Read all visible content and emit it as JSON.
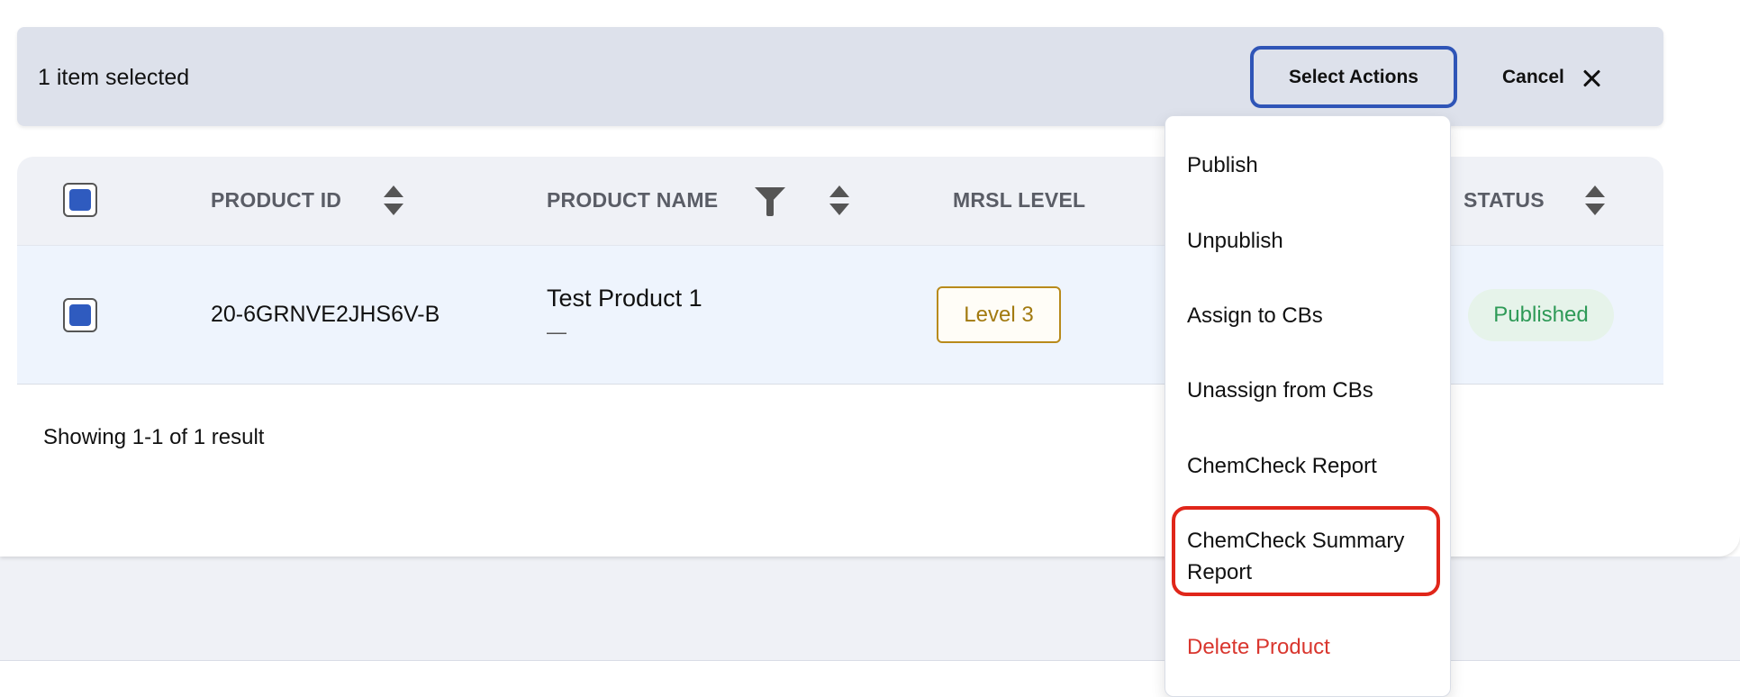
{
  "selection_bar": {
    "count_text": "1 item selected",
    "select_actions_label": "Select Actions",
    "cancel_label": "Cancel"
  },
  "table": {
    "columns": [
      {
        "label": "PRODUCT ID",
        "sortable": true
      },
      {
        "label": "PRODUCT NAME",
        "sortable": true,
        "filterable": true
      },
      {
        "label": "MRSL LEVEL"
      },
      {
        "label": "STATUS",
        "sortable": true
      }
    ],
    "rows": [
      {
        "checked": true,
        "product_id": "20-6GRNVE2JHS6V-B",
        "product_name": "Test Product 1",
        "product_sub": "—",
        "mrsl_level": "Level 3",
        "status": "Published"
      }
    ],
    "header_checked": true
  },
  "pagination": {
    "results_text": "Showing 1-1 of 1 result"
  },
  "actions_menu": {
    "items": [
      {
        "label": "Publish"
      },
      {
        "label": "Unpublish"
      },
      {
        "label": "Assign to CBs"
      },
      {
        "label": "Unassign from CBs"
      },
      {
        "label": "ChemCheck Report"
      },
      {
        "label_line1": "ChemCheck Summary",
        "label_line2": "Report",
        "highlighted": true
      },
      {
        "label": "Delete Product",
        "danger": true
      }
    ]
  },
  "colors": {
    "accent": "#2f5bbf",
    "highlight": "#e0261a",
    "status_published": "#2e9a57",
    "level_badge": "#a27a10",
    "danger": "#d9362e"
  }
}
